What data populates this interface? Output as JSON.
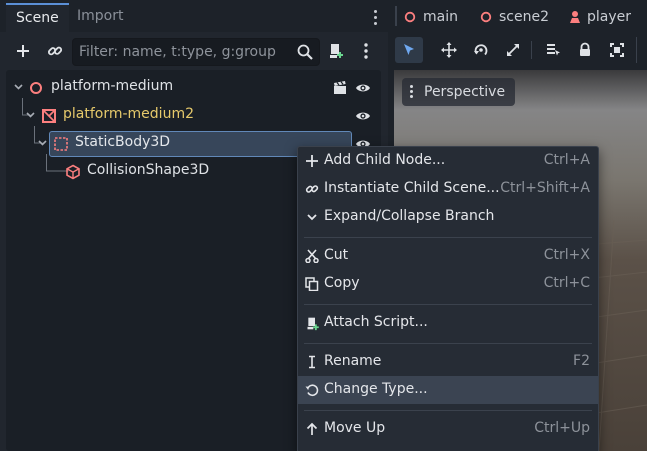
{
  "dock": {
    "tabs": [
      {
        "label": "Scene"
      },
      {
        "label": "Import"
      }
    ],
    "filter": {
      "placeholder": "Filter: name, t:type, g:group",
      "value": ""
    }
  },
  "tree": {
    "nodes": [
      {
        "label": "platform-medium",
        "icon": "circle-node-icon",
        "color": "#dfe2e6"
      },
      {
        "label": "platform-medium2",
        "icon": "inherited-scene-icon",
        "color": "#e6c96b"
      },
      {
        "label": "StaticBody3D",
        "icon": "static-body-icon",
        "color": "#e4e7eb"
      },
      {
        "label": "CollisionShape3D",
        "icon": "collision-shape-icon",
        "color": "#dfe2e6"
      }
    ]
  },
  "editor": {
    "scene_tabs": [
      {
        "label": "main",
        "icon": "circle-node-icon"
      },
      {
        "label": "scene2",
        "icon": "circle-node-icon"
      },
      {
        "label": "player",
        "icon": "character-icon"
      }
    ],
    "viewport_mode": "Perspective"
  },
  "context_menu": {
    "items": [
      {
        "label": "Add Child Node...",
        "shortcut": "Ctrl+A",
        "icon": "add-icon"
      },
      {
        "label": "Instantiate Child Scene...",
        "shortcut": "Ctrl+Shift+A",
        "icon": "link-icon"
      },
      {
        "label": "Expand/Collapse Branch",
        "shortcut": "",
        "icon": "chevron-down-icon"
      },
      {
        "label": "Cut",
        "shortcut": "Ctrl+X",
        "icon": "scissors-icon"
      },
      {
        "label": "Copy",
        "shortcut": "Ctrl+C",
        "icon": "copy-icon"
      },
      {
        "label": "Attach Script...",
        "shortcut": "",
        "icon": "script-add-icon"
      },
      {
        "label": "Rename",
        "shortcut": "F2",
        "icon": "rename-cursor-icon"
      },
      {
        "label": "Change Type...",
        "shortcut": "",
        "icon": "rotate-icon"
      },
      {
        "label": "Move Up",
        "shortcut": "Ctrl+Up",
        "icon": "arrow-up-icon"
      }
    ],
    "highlighted": "Change Type..."
  },
  "colors": {
    "accent": "#5b8fd6",
    "node_red": "#fc7f7f",
    "scene_inherited_yellow": "#e6c96b",
    "add_green": "#6ad58f"
  }
}
